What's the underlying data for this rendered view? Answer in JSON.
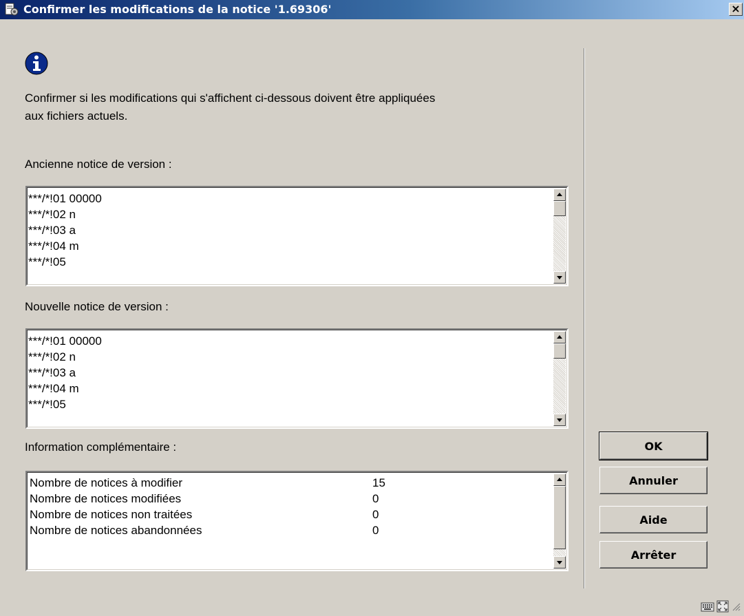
{
  "window": {
    "title": "Confirmer les modifications de la notice '1.69306'",
    "close_label": "×"
  },
  "message": {
    "line1": "Confirmer si les modifications qui s'affichent ci-dessous doivent être appliquées",
    "line2": "aux fichiers actuels."
  },
  "old_record": {
    "label": "Ancienne notice de version :",
    "lines": [
      "***/*!01 00000",
      "***/*!02 n",
      "***/*!03 a",
      "***/*!04 m",
      "***/*!05"
    ]
  },
  "new_record": {
    "label": "Nouvelle notice de version :",
    "lines": [
      "***/*!01 00000",
      "***/*!02 n",
      "***/*!03 a",
      "***/*!04 m",
      "***/*!05"
    ]
  },
  "additional_info": {
    "label": "Information complémentaire :",
    "rows": [
      {
        "label": "Nombre de notices à modifier",
        "value": "15"
      },
      {
        "label": "Nombre de notices modifiées",
        "value": "0"
      },
      {
        "label": "Nombre de notices non traitées",
        "value": "0"
      },
      {
        "label": "Nombre de notices abandonnées",
        "value": "0"
      }
    ]
  },
  "buttons": {
    "ok": "OK",
    "cancel": "Annuler",
    "help": "Aide",
    "stop": "Arrêter"
  },
  "icons": {
    "app": "app-icon",
    "info": "info-icon",
    "keyboard": "keyboard-icon",
    "resize": "resize-icon"
  },
  "colors": {
    "titlebar_start": "#0a246a",
    "titlebar_end": "#a6caf0",
    "dialog_bg": "#d4d0c8"
  }
}
